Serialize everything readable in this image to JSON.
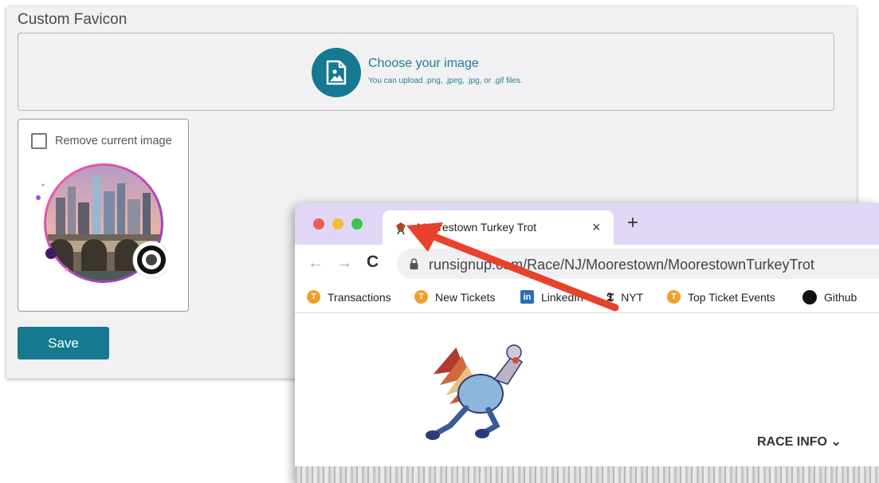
{
  "card": {
    "title": "Custom Favicon",
    "upload": {
      "title": "Choose your image",
      "hint": "You can upload .png, .jpeg, .jpg, or .gif files."
    },
    "current_image": {
      "remove_label": "Remove current image"
    },
    "save_label": "Save"
  },
  "browser": {
    "tab": {
      "title": "Moorestown Turkey Trot",
      "close": "×",
      "new_tab": "+"
    },
    "toolbar": {
      "back": "←",
      "forward": "→",
      "reload": "C",
      "url": "runsignup.com/Race/NJ/Moorestown/MoorestownTurkeyTrot"
    },
    "bookmarks": [
      {
        "label": "Transactions",
        "icon": "t-badge-icon"
      },
      {
        "label": "New Tickets",
        "icon": "t-badge-icon"
      },
      {
        "label": "LinkedIn",
        "icon": "linkedin-icon"
      },
      {
        "label": "NYT",
        "icon": "nyt-icon"
      },
      {
        "label": "Top Ticket Events",
        "icon": "t-badge-icon"
      },
      {
        "label": "Github",
        "icon": "github-icon"
      }
    ],
    "page": {
      "menu_label": "RACE INFO",
      "menu_caret": "⌄"
    }
  },
  "colors": {
    "primary": "#15798f",
    "tab_strip": "#e1d6f5",
    "annotation_arrow": "#e8412c"
  }
}
